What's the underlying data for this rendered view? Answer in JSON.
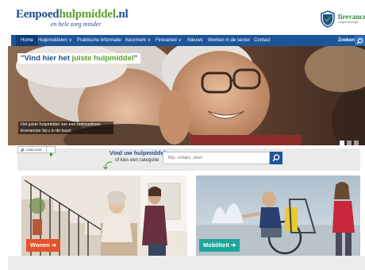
{
  "header": {
    "logo": {
      "main_a": "Eenpoed",
      "main_b": "hulpmiddel",
      "main_c": ".nl",
      "tagline": "en hele zorg minder"
    },
    "partner": {
      "name": "firevanced",
      "sub": "zorgtechnologie"
    }
  },
  "nav": {
    "items": [
      {
        "label": "Home",
        "active": true
      },
      {
        "label": "Hulpmiddelen ∨"
      },
      {
        "label": "Praktische informatie"
      },
      {
        "label": "Keurmerk ∨"
      },
      {
        "label": "Firevaned ∨"
      },
      {
        "label": "Nieuws"
      },
      {
        "label": "Werken in de sector"
      },
      {
        "label": "Contact"
      }
    ],
    "search_label": "Zoeken"
  },
  "hero": {
    "quote_a": "\"Vind hier het ",
    "quote_b": "juiste hulpmiddel",
    "quote_c": "\"",
    "caption": "Het juiste hulpmiddel van een betrouwbare leverancier bij u in de buurt"
  },
  "readspeaker": {
    "label": "🔊 Lees voor"
  },
  "search": {
    "title": "Vind uw hulpmiddel",
    "subtitle": "of kies een categorie",
    "placeholder": "Bijv. rollator, stoel"
  },
  "categories": [
    {
      "label": "Wonen ➔"
    },
    {
      "label": "Mobiliteit ➔"
    }
  ],
  "colors": {
    "brand_blue": "#1c5599",
    "brand_green": "#5aa02c",
    "wonen": "#e2532a",
    "mobiliteit": "#1fa69c"
  }
}
